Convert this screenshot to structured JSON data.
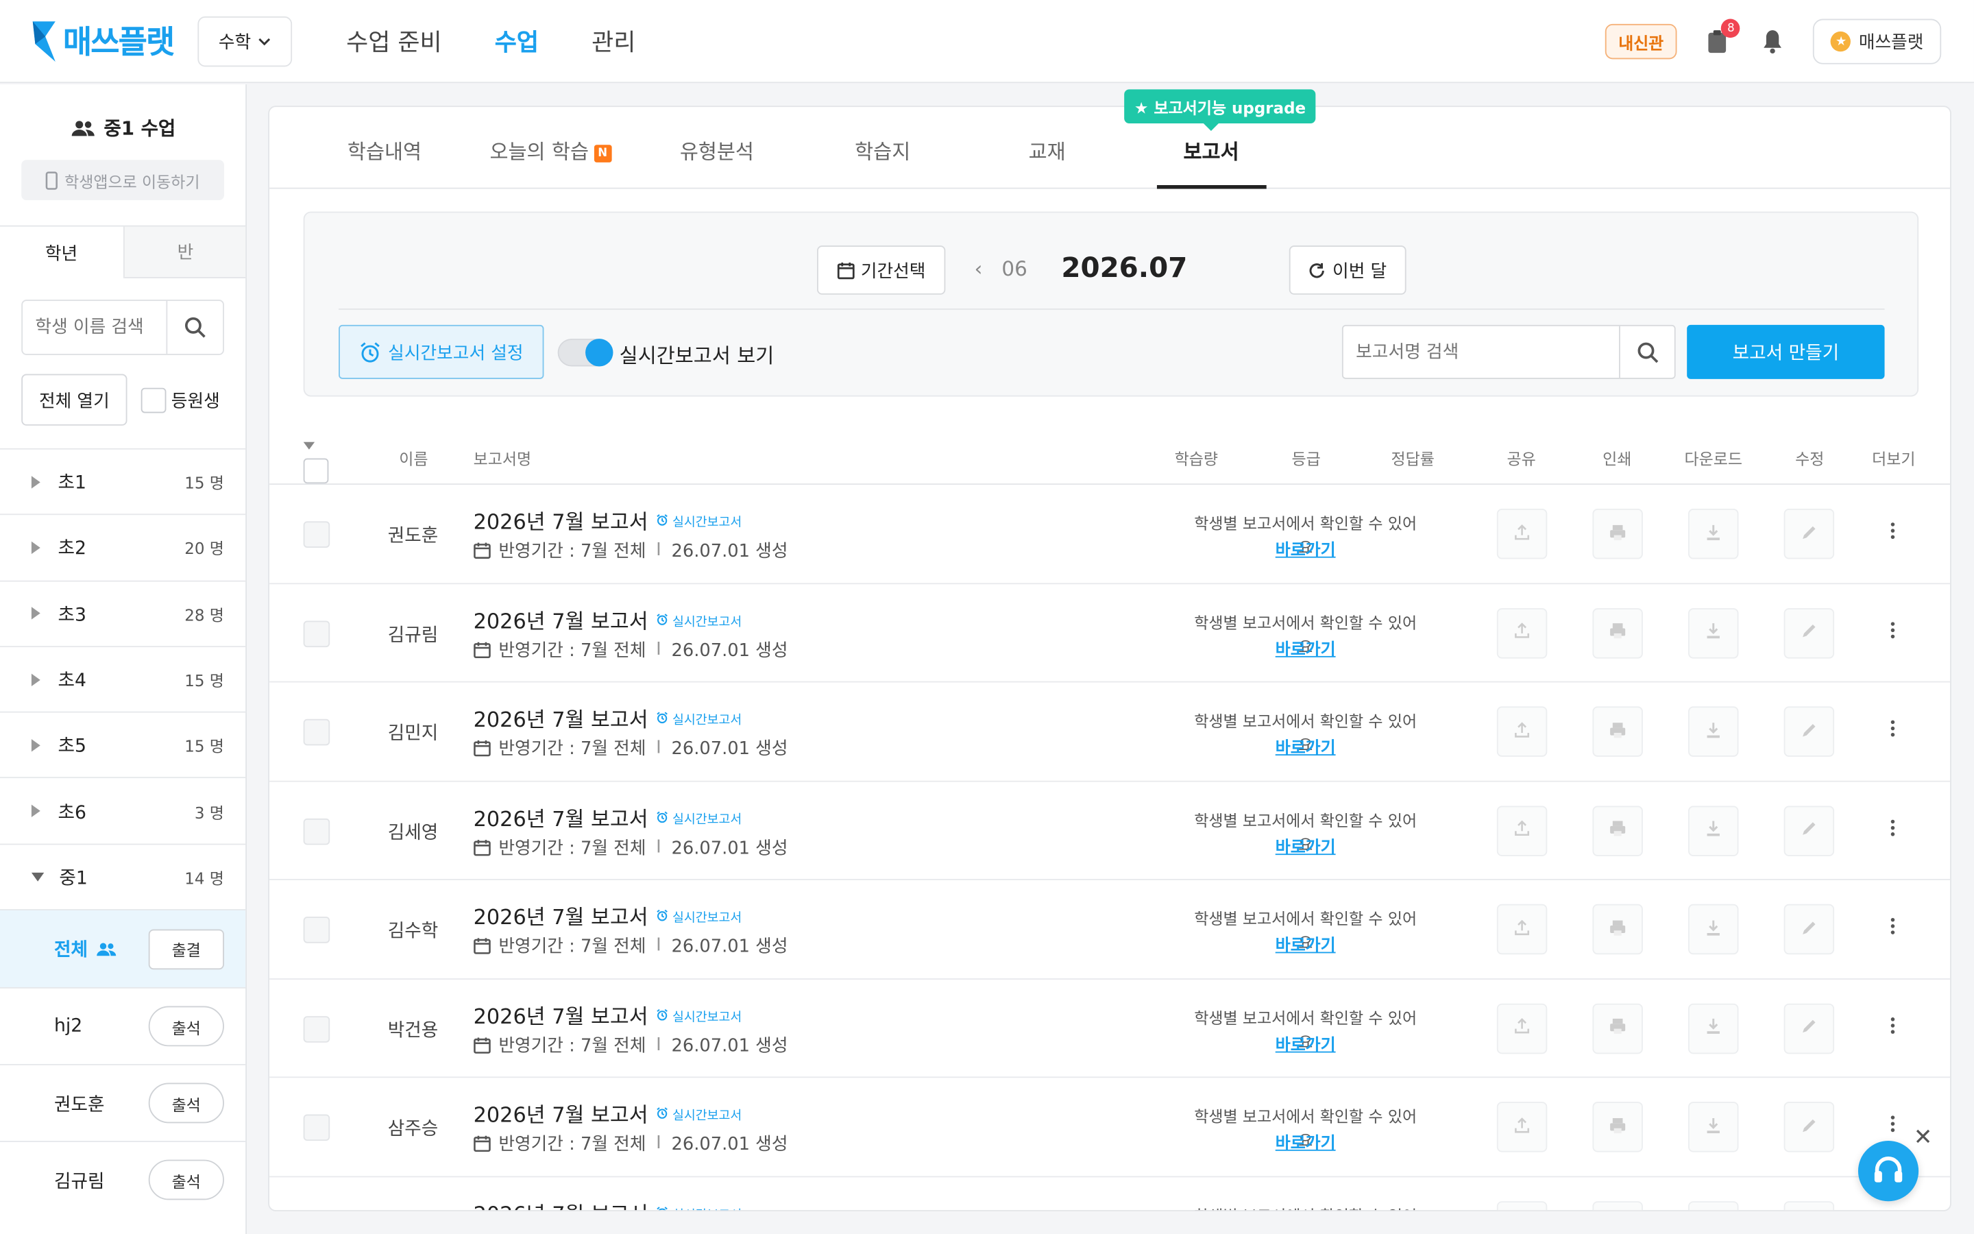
{
  "header": {
    "logo": "매쓰플랫",
    "subject": "수학",
    "nav": [
      {
        "label": "수업 준비",
        "active": false
      },
      {
        "label": "수업",
        "active": true
      },
      {
        "label": "관리",
        "active": false
      }
    ],
    "badge": "내신관",
    "notif_count": "8",
    "profile": "매쓰플랫",
    "profile_icon": "★"
  },
  "sidebar": {
    "class_title": "중1 수업",
    "move_app": "학생앱으로 이동하기",
    "tabs": [
      "학년",
      "반"
    ],
    "search_placeholder": "학생 이름 검색",
    "open_all": "전체 열기",
    "enrolled": "등원생",
    "grades": [
      {
        "name": "초1",
        "count": "15 명"
      },
      {
        "name": "초2",
        "count": "20 명"
      },
      {
        "name": "초3",
        "count": "28 명"
      },
      {
        "name": "초4",
        "count": "15 명"
      },
      {
        "name": "초5",
        "count": "15 명"
      },
      {
        "name": "초6",
        "count": "3 명"
      },
      {
        "name": "중1",
        "count": "14 명"
      }
    ],
    "all_label": "전체",
    "all_attend": "출결",
    "students": [
      {
        "name": "hj2",
        "attend": "출석"
      },
      {
        "name": "권도훈",
        "attend": "출석"
      },
      {
        "name": "김규림",
        "attend": "출석"
      }
    ]
  },
  "tabs": [
    {
      "label": "학습내역"
    },
    {
      "label": "오늘의 학습",
      "badge": "N"
    },
    {
      "label": "유형분석"
    },
    {
      "label": "학습지"
    },
    {
      "label": "교재"
    },
    {
      "label": "보고서",
      "active": true
    }
  ],
  "upgrade": "★ 보고서기능 upgrade",
  "filter": {
    "period_btn": "기간선택",
    "prev_month": "06",
    "current": "2026.07",
    "this_month": "이번 달",
    "realtime_setting": "실시간보고서 설정",
    "realtime_view": "실시간보고서 보기",
    "search_placeholder": "보고서명 검색",
    "create": "보고서 만들기"
  },
  "table": {
    "headers": {
      "name": "이름",
      "title": "보고서명",
      "amount": "학습량",
      "grade": "등급",
      "rate": "정답률",
      "share": "공유",
      "print": "인쇄",
      "download": "다운로드",
      "edit": "수정",
      "more": "더보기"
    },
    "rt_badge": "실시간보고서",
    "period_label": "반영기간 : 7월 전체",
    "sep": "I",
    "created": "26.07.01 생성",
    "msg": "학생별 보고서에서 확인할 수 있어요",
    "link": "바로가기",
    "report_title": "2026년 7월 보고서",
    "rows": [
      {
        "name": "권도훈"
      },
      {
        "name": "김규림"
      },
      {
        "name": "김민지"
      },
      {
        "name": "김세영"
      },
      {
        "name": "김수학"
      },
      {
        "name": "박건용"
      },
      {
        "name": "삼주승"
      },
      {
        "name": ""
      }
    ]
  }
}
